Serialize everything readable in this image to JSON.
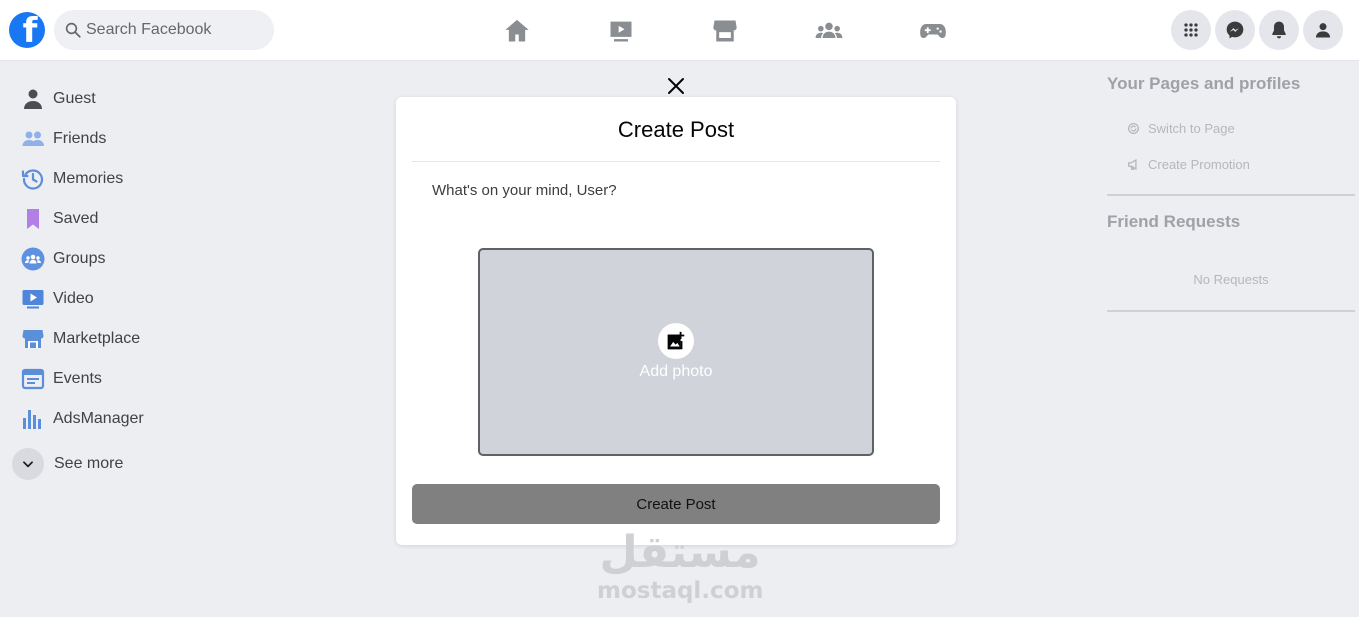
{
  "header": {
    "logo_letter": "f",
    "search_placeholder": "Search Facebook",
    "nav_icons": [
      "home-icon",
      "video-icon",
      "marketplace-icon",
      "groups-icon",
      "gaming-icon"
    ],
    "right_icons": [
      "menu-grid-icon",
      "messenger-icon",
      "notifications-icon",
      "account-icon"
    ],
    "brand_color": "#1877f2"
  },
  "sidebar": {
    "items": [
      {
        "label": "Guest",
        "icon": "user-icon"
      },
      {
        "label": "Friends",
        "icon": "friends-icon"
      },
      {
        "label": "Memories",
        "icon": "memories-icon"
      },
      {
        "label": "Saved",
        "icon": "bookmark-icon"
      },
      {
        "label": "Groups",
        "icon": "groups-icon"
      },
      {
        "label": "Video",
        "icon": "video-icon"
      },
      {
        "label": "Marketplace",
        "icon": "marketplace-icon"
      },
      {
        "label": "Events",
        "icon": "events-icon"
      },
      {
        "label": "AdsManager",
        "icon": "ads-manager-icon"
      }
    ],
    "see_more": "See more"
  },
  "right_panel": {
    "pages_title": "Your Pages and profiles",
    "switch_page": "Switch to Page",
    "create_promotion": "Create Promotion",
    "friend_requests_title": "Friend Requests",
    "no_requests": "No Requests"
  },
  "modal": {
    "title": "Create Post",
    "prompt": "What's on your mind, User?",
    "add_photo": "Add photo",
    "submit": "Create Post"
  },
  "watermark": {
    "arabic": "مستقل",
    "latin": "mostaql.com"
  }
}
